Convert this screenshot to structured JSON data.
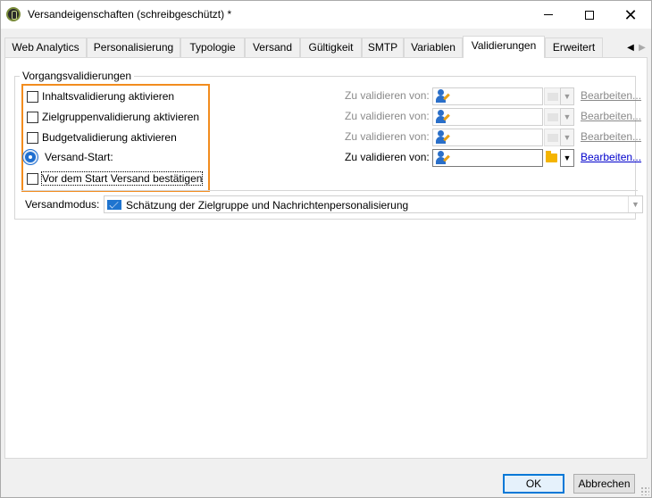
{
  "window": {
    "title": "Versandeigenschaften (schreibgeschützt) *"
  },
  "titlebar": {
    "min_icon": "minimize-icon",
    "max_icon": "maximize-icon",
    "close_icon": "close-icon",
    "close_glyph": "✕"
  },
  "tabs": [
    {
      "label": "Web Analytics"
    },
    {
      "label": "Personalisierung"
    },
    {
      "label": "Typologie"
    },
    {
      "label": "Versand"
    },
    {
      "label": "Gültigkeit"
    },
    {
      "label": "SMTP"
    },
    {
      "label": "Variablen"
    },
    {
      "label": "Validierungen",
      "active": true
    },
    {
      "label": "Erweitert"
    }
  ],
  "tab_scroll": {
    "left": "◀",
    "right": "▶"
  },
  "group": {
    "label": "Vorgangsvalidierungen"
  },
  "rows": [
    {
      "label": "Inhaltsvalidierung aktivieren",
      "validate_label": "Zu validieren von:",
      "edit": "Bearbeiten..."
    },
    {
      "label": "Zielgruppenvalidierung aktivieren",
      "validate_label": "Zu validieren von:",
      "edit": "Bearbeiten..."
    },
    {
      "label": "Budgetvalidierung aktivieren",
      "validate_label": "Zu validieren von:",
      "edit": "Bearbeiten..."
    },
    {
      "label": "Versand-Start:",
      "validate_label": "Zu validieren von:",
      "edit": "Bearbeiten..."
    }
  ],
  "confirm": {
    "label": "Vor dem Start Versand bestätigen"
  },
  "mode": {
    "label": "Versandmodus:",
    "value": "Schätzung der Zielgruppe und Nachrichtenpersonalisierung"
  },
  "dropdown_glyph": "▼",
  "footer": {
    "ok": "OK",
    "cancel": "Abbrechen"
  },
  "colors": {
    "highlight": "#f28c1e",
    "link": "#0000cc",
    "accent": "#0078d7"
  }
}
